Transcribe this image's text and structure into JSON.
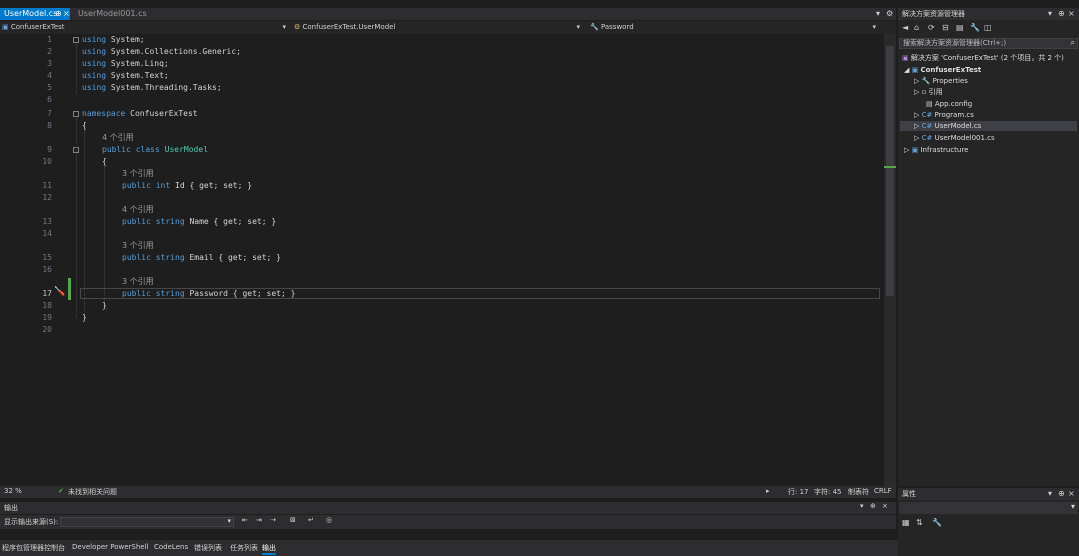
{
  "tabs": [
    {
      "label": "UserModel.cs",
      "pin": "⊕",
      "close": "×"
    },
    {
      "label": "UserModel001.cs"
    }
  ],
  "tabbar_controls": {
    "dropdown": "▾",
    "settings": "⚙"
  },
  "navbar": {
    "project": "ConfuserExTest",
    "class": "ConfuserExTest.UserModel",
    "member": "Password"
  },
  "editor": {
    "line_numbers": [
      "1",
      "2",
      "3",
      "4",
      "5",
      "6",
      "7",
      "8",
      "9",
      "10",
      "11",
      "12",
      "13",
      "14",
      "15",
      "16",
      "17",
      "18",
      "19",
      "20"
    ],
    "lines": {
      "l1": {
        "kw": "using",
        "rest": " System;"
      },
      "l2": {
        "kw": "using",
        "rest": " System.Collections.Generic;"
      },
      "l3": {
        "kw": "using",
        "rest": " System.Linq;"
      },
      "l4": {
        "kw": "using",
        "rest": " System.Text;"
      },
      "l5": {
        "kw": "using",
        "rest": " System.Threading.Tasks;"
      },
      "l7": {
        "kw": "namespace",
        "rest": " ConfuserExTest"
      },
      "l8": "{",
      "lens9": "4 个引用",
      "l9": {
        "kw1": "public",
        "kw2": "class",
        "ty": "UserModel"
      },
      "l10": "{",
      "lens11": "3 个引用",
      "l11": {
        "kw1": "public",
        "kw2": "int",
        "rest": " Id { get; set; }"
      },
      "lens13": "4 个引用",
      "l13": {
        "kw1": "public",
        "kw2": "string",
        "rest": " Name { get; set; }"
      },
      "lens15": "3 个引用",
      "l15": {
        "kw1": "public",
        "kw2": "string",
        "rest": " Email { get; set; }"
      },
      "lens17": "3 个引用",
      "l17": {
        "kw1": "public",
        "kw2": "string",
        "rest": " Password { get; set; }"
      },
      "l18": "}",
      "l19": "}"
    }
  },
  "status": {
    "zoom": "32 %",
    "issues": "未找到相关问题",
    "line": "行: 17",
    "col": "字符: 45",
    "mode": "制表符",
    "eol": "CRLF"
  },
  "output": {
    "title": "输出",
    "source_label": "显示输出来源(S):",
    "source_value": ""
  },
  "bottom_tabs": [
    "程序包管理器控制台",
    "Developer PowerShell",
    "CodeLens",
    "错误列表",
    "任务列表",
    "输出"
  ],
  "solution_explorer": {
    "title": "解决方案资源管理器",
    "search_placeholder": "搜索解决方案资源管理器(Ctrl+;)",
    "solution": "解决方案 'ConfuserExTest' (2 个项目，共 2 个)",
    "project": "ConfuserExTest",
    "items": [
      "Properties",
      "引用",
      "App.config",
      "Program.cs",
      "UserModel.cs",
      "UserModel001.cs"
    ],
    "other_project": "Infrastructure"
  },
  "properties": {
    "title": "属性"
  },
  "colors": {
    "accent": "#007acc",
    "keyword": "#569cd6",
    "type": "#4ec9b0",
    "background": "#1e1e1e"
  }
}
